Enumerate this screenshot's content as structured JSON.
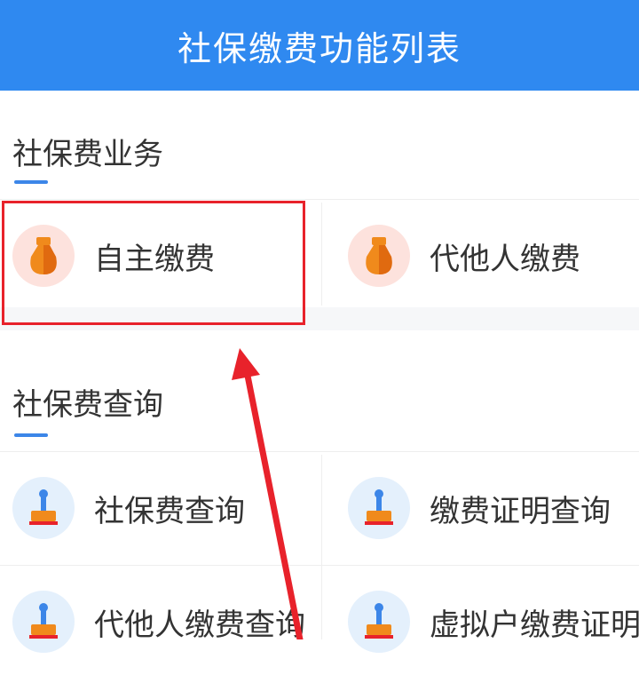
{
  "header": {
    "title": "社保缴费功能列表"
  },
  "sections": [
    {
      "title": "社保费业务",
      "items": [
        {
          "label": "自主缴费",
          "icon": "money-bag-icon"
        },
        {
          "label": "代他人缴费",
          "icon": "money-bag-icon"
        }
      ]
    },
    {
      "title": "社保费查询",
      "items": [
        {
          "label": "社保费查询",
          "icon": "stamp-icon"
        },
        {
          "label": "缴费证明查询",
          "icon": "stamp-icon"
        },
        {
          "label": "代他人缴费查询",
          "icon": "stamp-icon"
        },
        {
          "label": "虚拟户缴费证明",
          "icon": "stamp-icon"
        }
      ]
    }
  ],
  "colors": {
    "header_bg": "#2f89f0",
    "accent_underline": "#3c86e8",
    "highlight_border": "#e8222b",
    "bag_icon": "#f08a1c",
    "stamp_icon": "#f08a1c"
  }
}
